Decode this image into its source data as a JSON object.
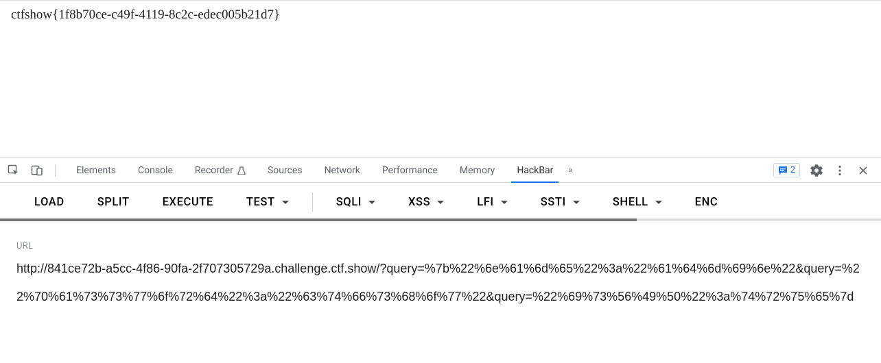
{
  "page": {
    "flag_text": "ctfshow{1f8b70ce-c49f-4119-8c2c-edec005b21d7}"
  },
  "devtools": {
    "tabs": {
      "elements": "Elements",
      "console": "Console",
      "recorder": "Recorder",
      "sources": "Sources",
      "network": "Network",
      "performance": "Performance",
      "memory": "Memory",
      "hackbar": "HackBar"
    },
    "more_tabs_glyph": "»",
    "issues_count": "2"
  },
  "hackbar": {
    "buttons": {
      "load": "LOAD",
      "split": "SPLIT",
      "execute": "EXECUTE",
      "test": "TEST",
      "sqli": "SQLI",
      "xss": "XSS",
      "lfi": "LFI",
      "ssti": "SSTI",
      "shell": "SHELL",
      "enc": "ENC"
    },
    "url_label": "URL",
    "url_value": "http://841ce72b-a5cc-4f86-90fa-2f707305729a.challenge.ctf.show/?query=%7b%22%6e%61%6d%65%22%3a%22%61%64%6d%69%6e%22&query=%22%70%61%73%73%77%6f%72%64%22%3a%22%63%74%66%73%68%6f%77%22&query=%22%69%73%56%49%50%22%3a%74%72%75%65%7d"
  }
}
